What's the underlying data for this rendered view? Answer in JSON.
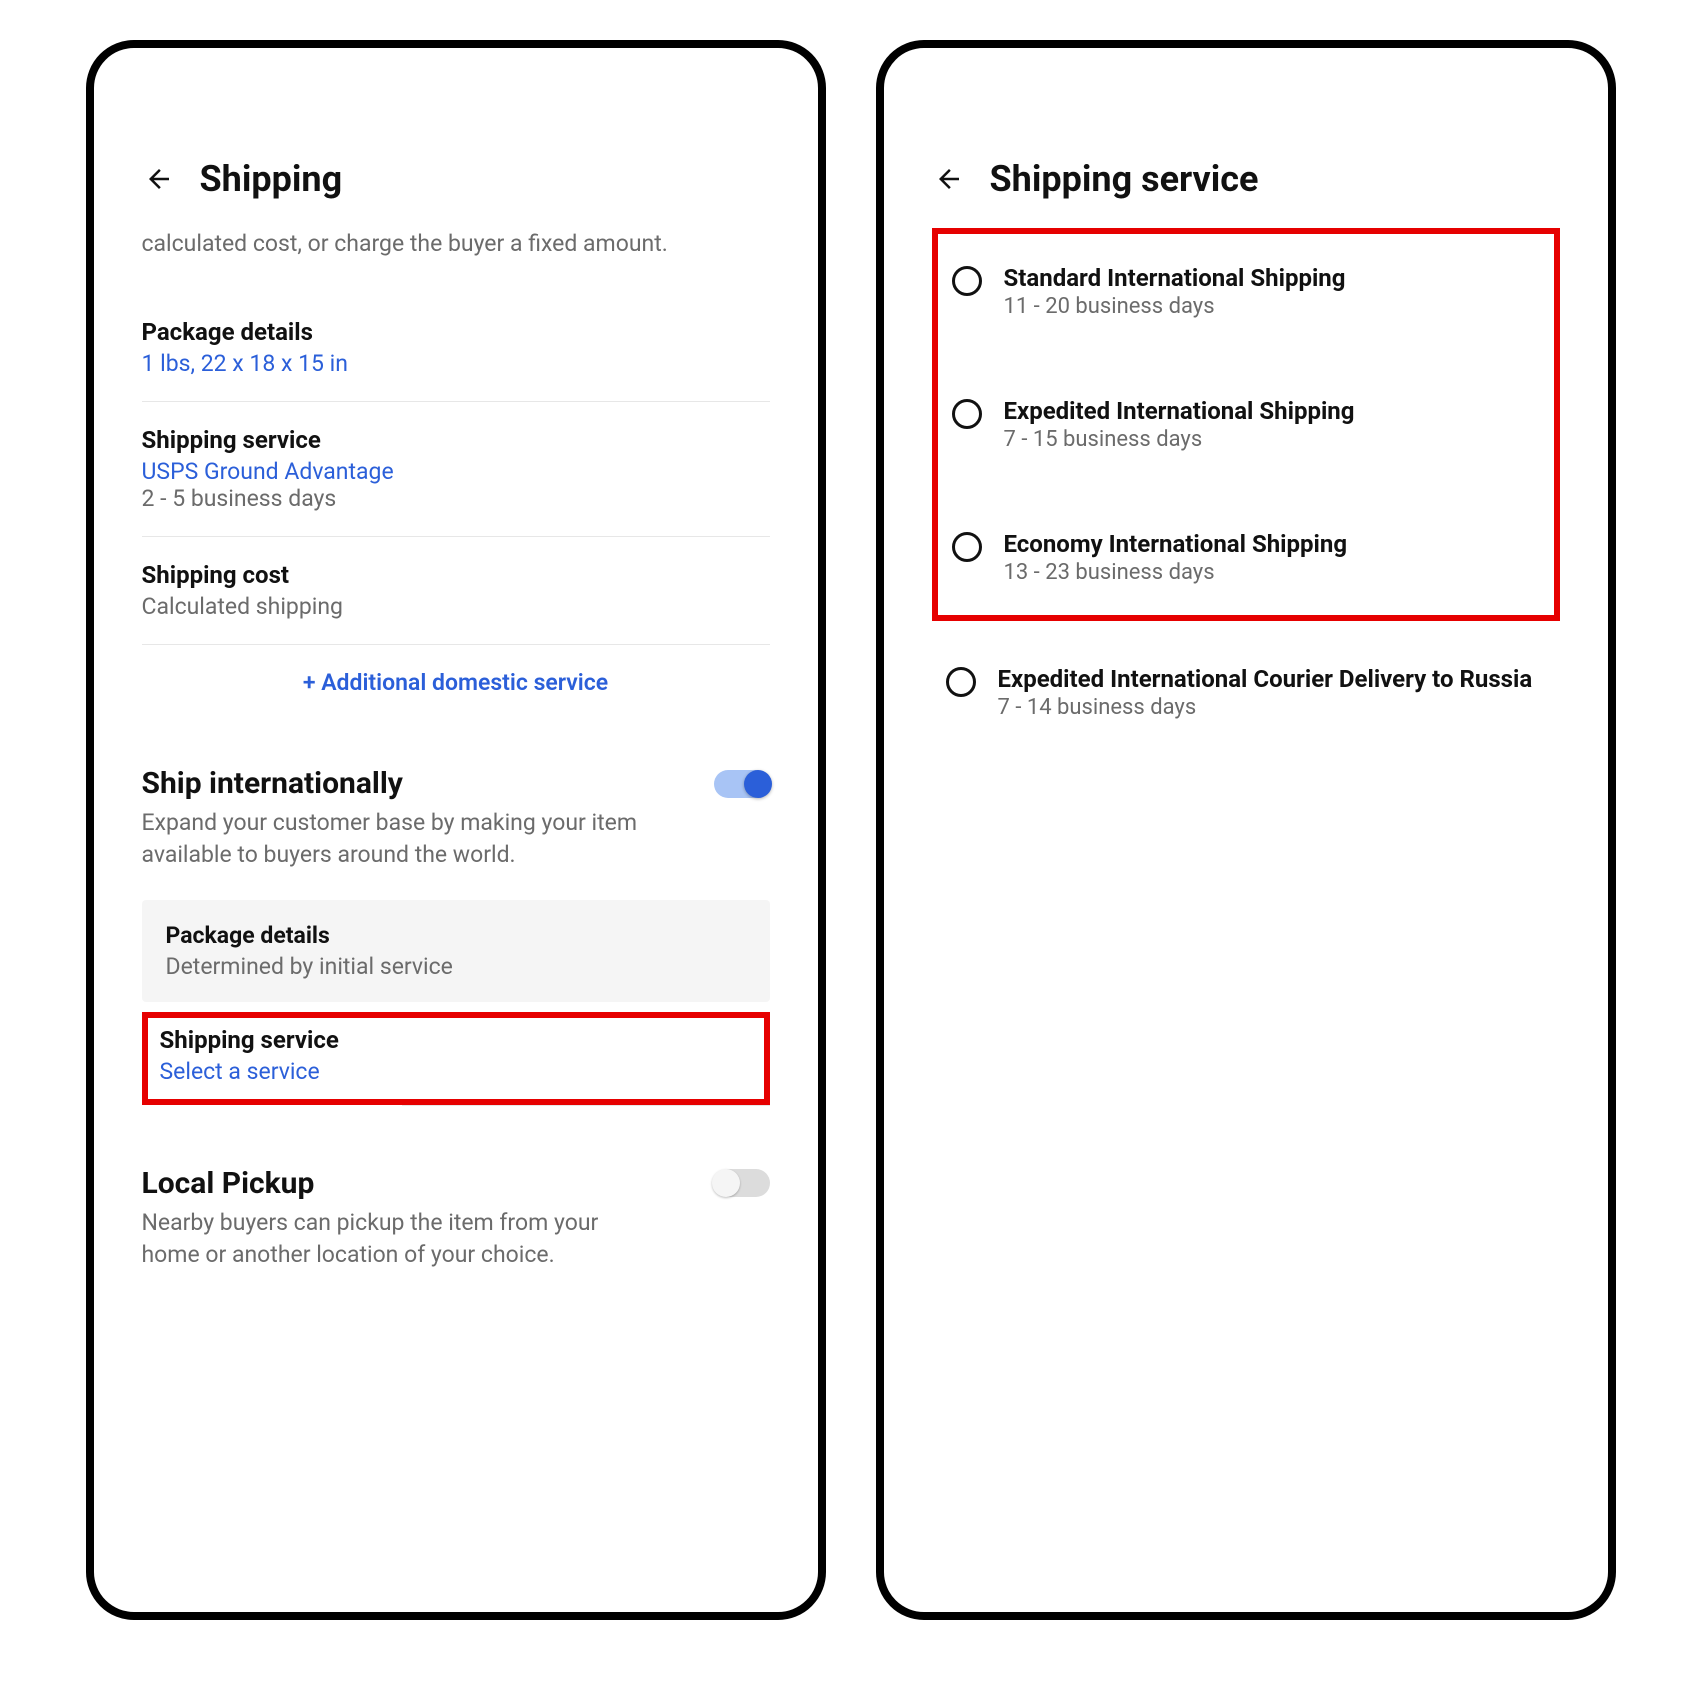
{
  "left": {
    "title": "Shipping",
    "intro": "calculated cost, or charge the buyer a fixed amount.",
    "package_details": {
      "label": "Package details",
      "value": "1 lbs, 22 x 18 x 15 in"
    },
    "shipping_service": {
      "label": "Shipping service",
      "value": "USPS Ground Advantage",
      "subtext": "2 - 5 business days"
    },
    "shipping_cost": {
      "label": "Shipping cost",
      "value": "Calculated shipping"
    },
    "add_service_label": "+ Additional domestic service",
    "intl": {
      "title": "Ship internationally",
      "desc": "Expand your customer base by making your item available to buyers around the world.",
      "toggle_on": true,
      "package_details": {
        "label": "Package details",
        "value": "Determined by initial service"
      },
      "shipping_service": {
        "label": "Shipping service",
        "value": "Select a service"
      }
    },
    "local_pickup": {
      "title": "Local Pickup",
      "desc": "Nearby buyers can pickup the item from your home or another location of your choice.",
      "toggle_on": false
    }
  },
  "right": {
    "title": "Shipping service",
    "highlighted_options": [
      {
        "title": "Standard International Shipping",
        "sub": "11 - 20 business days"
      },
      {
        "title": "Expedited International Shipping",
        "sub": "7 - 15 business days"
      },
      {
        "title": "Economy International Shipping",
        "sub": "13 - 23 business days"
      }
    ],
    "other_options": [
      {
        "title": "Expedited International Courier Delivery to Russia",
        "sub": "7 - 14 business days"
      }
    ]
  }
}
